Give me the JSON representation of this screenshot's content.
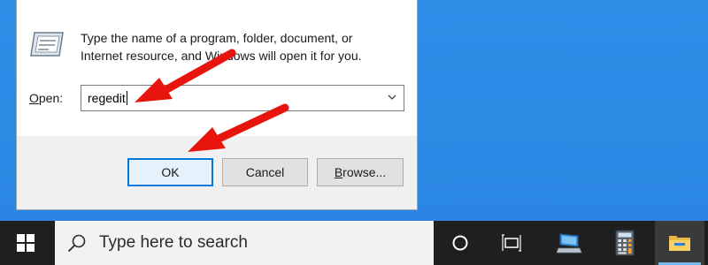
{
  "dialog": {
    "description": "Type the name of a program, folder, document, or\nInternet resource, and Windows will open it for you.",
    "open_label_accel": "O",
    "open_label_rest": "pen:",
    "command_value": "regedit",
    "buttons": {
      "ok": "OK",
      "cancel": "Cancel",
      "browse_accel": "B",
      "browse_rest": "rowse..."
    }
  },
  "taskbar": {
    "search_placeholder": "Type here to search",
    "icons": [
      "windows-start-icon",
      "search-icon",
      "cortana-icon",
      "task-view-icon",
      "network-pc-icon",
      "calculator-icon",
      "file-explorer-icon"
    ]
  },
  "colors": {
    "desktop": "#2c8ae6",
    "taskbar": "#1f1f1f",
    "arrow": "#e8150e",
    "ok_border": "#0078d7"
  }
}
